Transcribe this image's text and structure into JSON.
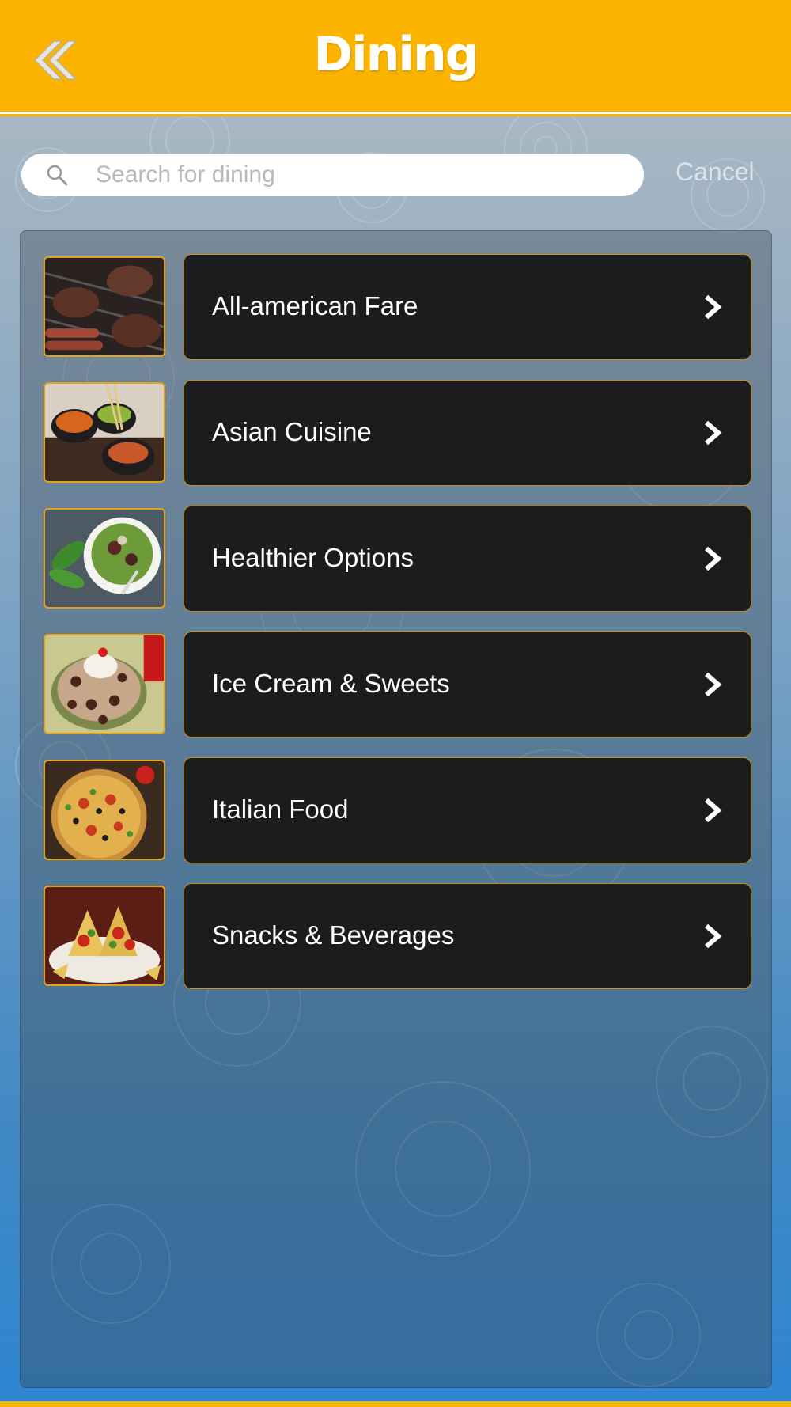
{
  "header": {
    "title": "Dining",
    "back_icon": "double-chevron-left-icon"
  },
  "search": {
    "placeholder": "Search for dining",
    "value": "",
    "cancel_label": "Cancel"
  },
  "categories": [
    {
      "label": "All-american Fare",
      "image": "grilled-burgers-and-sausages"
    },
    {
      "label": "Asian Cuisine",
      "image": "asian-dishes-with-chopsticks"
    },
    {
      "label": "Healthier Options",
      "image": "salad-bowl"
    },
    {
      "label": "Ice Cream & Sweets",
      "image": "ice-cream-sundae"
    },
    {
      "label": "Italian Food",
      "image": "pizza"
    },
    {
      "label": "Snacks & Beverages",
      "image": "tacos-and-nachos"
    }
  ],
  "colors": {
    "header": "#fdb400",
    "item_background": "#1b1c1e",
    "item_border": "#c8901a",
    "thumb_border": "#e2a31b",
    "text": "#ffffff"
  }
}
